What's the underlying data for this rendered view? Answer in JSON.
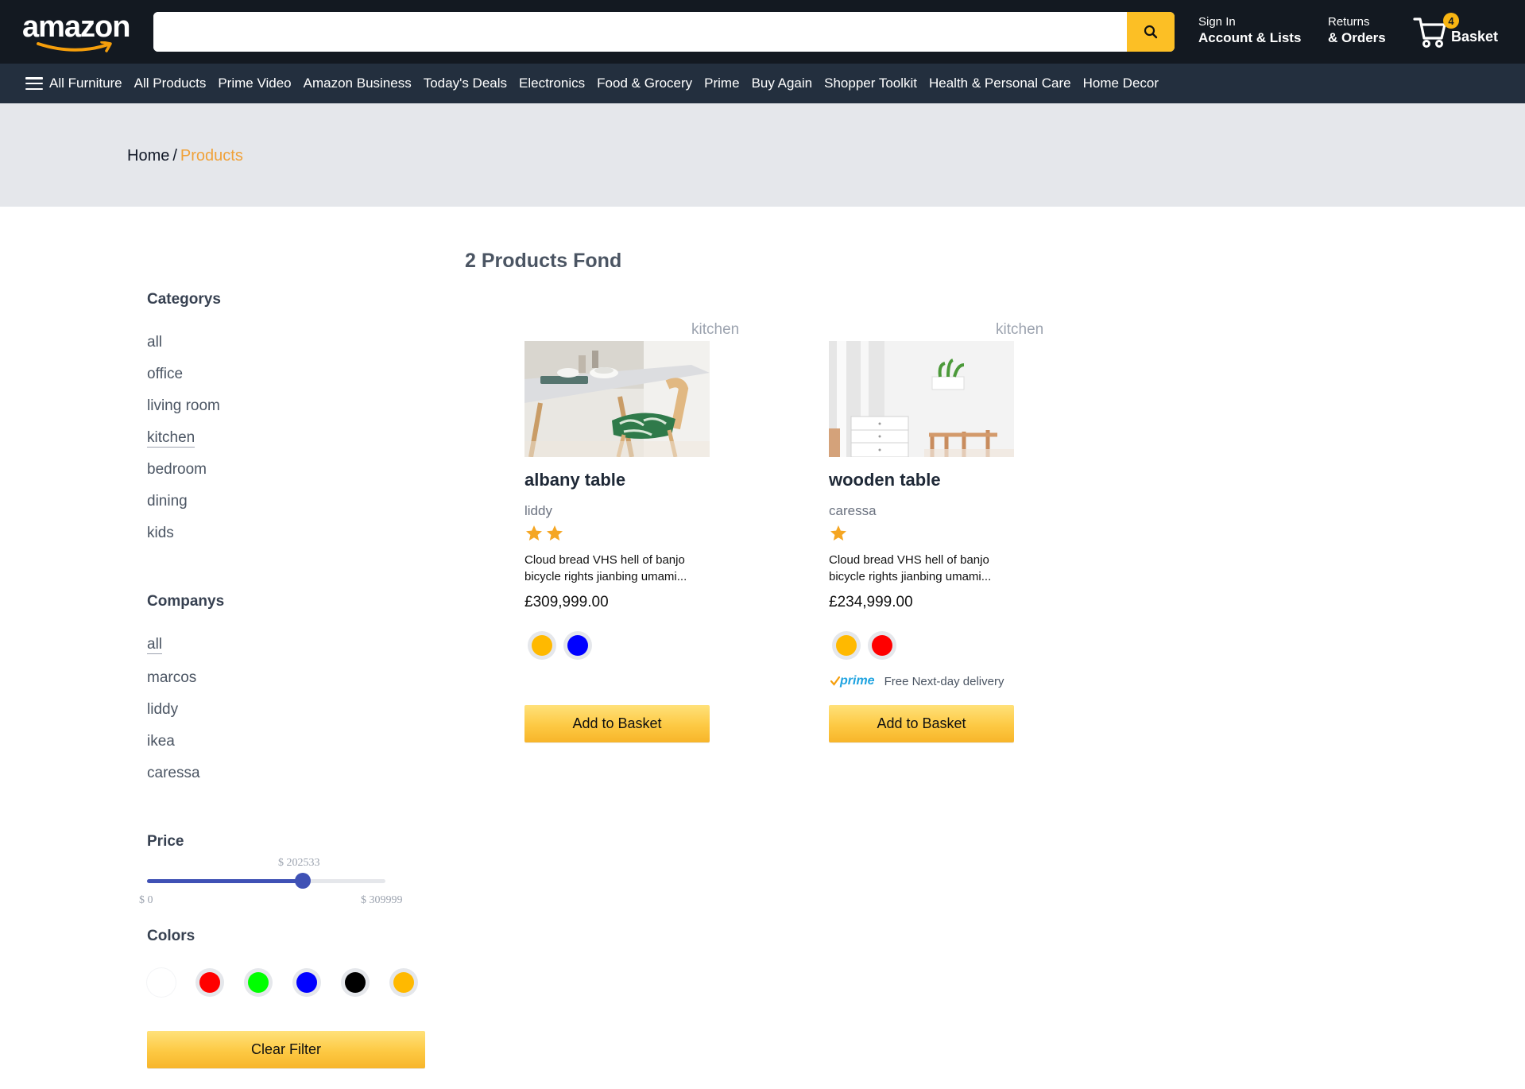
{
  "header": {
    "logo_text": "amazon",
    "search_placeholder": "",
    "signin_small": "Sign In",
    "signin_big": "Account & Lists",
    "returns_small": "Returns",
    "returns_big": "& Orders",
    "basket_label": "Basket",
    "basket_count": "4"
  },
  "nav": {
    "items": [
      "All Furniture",
      "All Products",
      "Prime Video",
      "Amazon Business",
      "Today's Deals",
      "Electronics",
      "Food & Grocery",
      "Prime",
      "Buy Again",
      "Shopper Toolkit",
      "Health & Personal Care",
      "Home Decor"
    ]
  },
  "breadcrumb": {
    "home": "Home",
    "separator": "/",
    "current": "Products"
  },
  "sidebar": {
    "categories_heading": "Categorys",
    "categories": [
      "all",
      "office",
      "living room",
      "kitchen",
      "bedroom",
      "dining",
      "kids"
    ],
    "active_category": "kitchen",
    "companies_heading": "Companys",
    "companies": [
      "all",
      "marcos",
      "liddy",
      "ikea",
      "caressa"
    ],
    "active_company": "all",
    "price_heading": "Price",
    "price_current_label": "$ 202533",
    "price_current": 202533,
    "price_min_label": "$ 0",
    "price_max_label": "$ 309999",
    "price_min": 0,
    "price_max": 309999,
    "colors_heading": "Colors",
    "colors": [
      "#ffffff",
      "#ff0000",
      "#00ff00",
      "#0000ff",
      "#000000",
      "#ffb900"
    ],
    "clear_label": "Clear Filter"
  },
  "results": {
    "count_text": "2 Products Fond"
  },
  "products": [
    {
      "category": "kitchen",
      "name": "albany table",
      "brand": "liddy",
      "stars": 2,
      "description_line1": "Cloud bread VHS hell of banjo",
      "description_line2": "bicycle rights jianbing umami...",
      "price": "£309,999.00",
      "colors": [
        "#ffb900",
        "#0000ff"
      ],
      "prime": false,
      "add_label": "Add to Basket"
    },
    {
      "category": "kitchen",
      "name": "wooden table",
      "brand": "caressa",
      "stars": 1,
      "description_line1": "Cloud bread VHS hell of banjo",
      "description_line2": "bicycle rights jianbing umami...",
      "price": "£234,999.00",
      "colors": [
        "#ffb900",
        "#ff0000"
      ],
      "prime": true,
      "prime_logo": "prime",
      "prime_text": "Free Next-day delivery",
      "add_label": "Add to Basket"
    }
  ],
  "accent_colors": {
    "header_bg": "#131921",
    "nav_bg": "#232f3e",
    "crumb_bg": "#e5e7eb",
    "breadcrumb_current": "#f0a23a",
    "slider": "#3f51b5",
    "button": "#fdc943"
  }
}
